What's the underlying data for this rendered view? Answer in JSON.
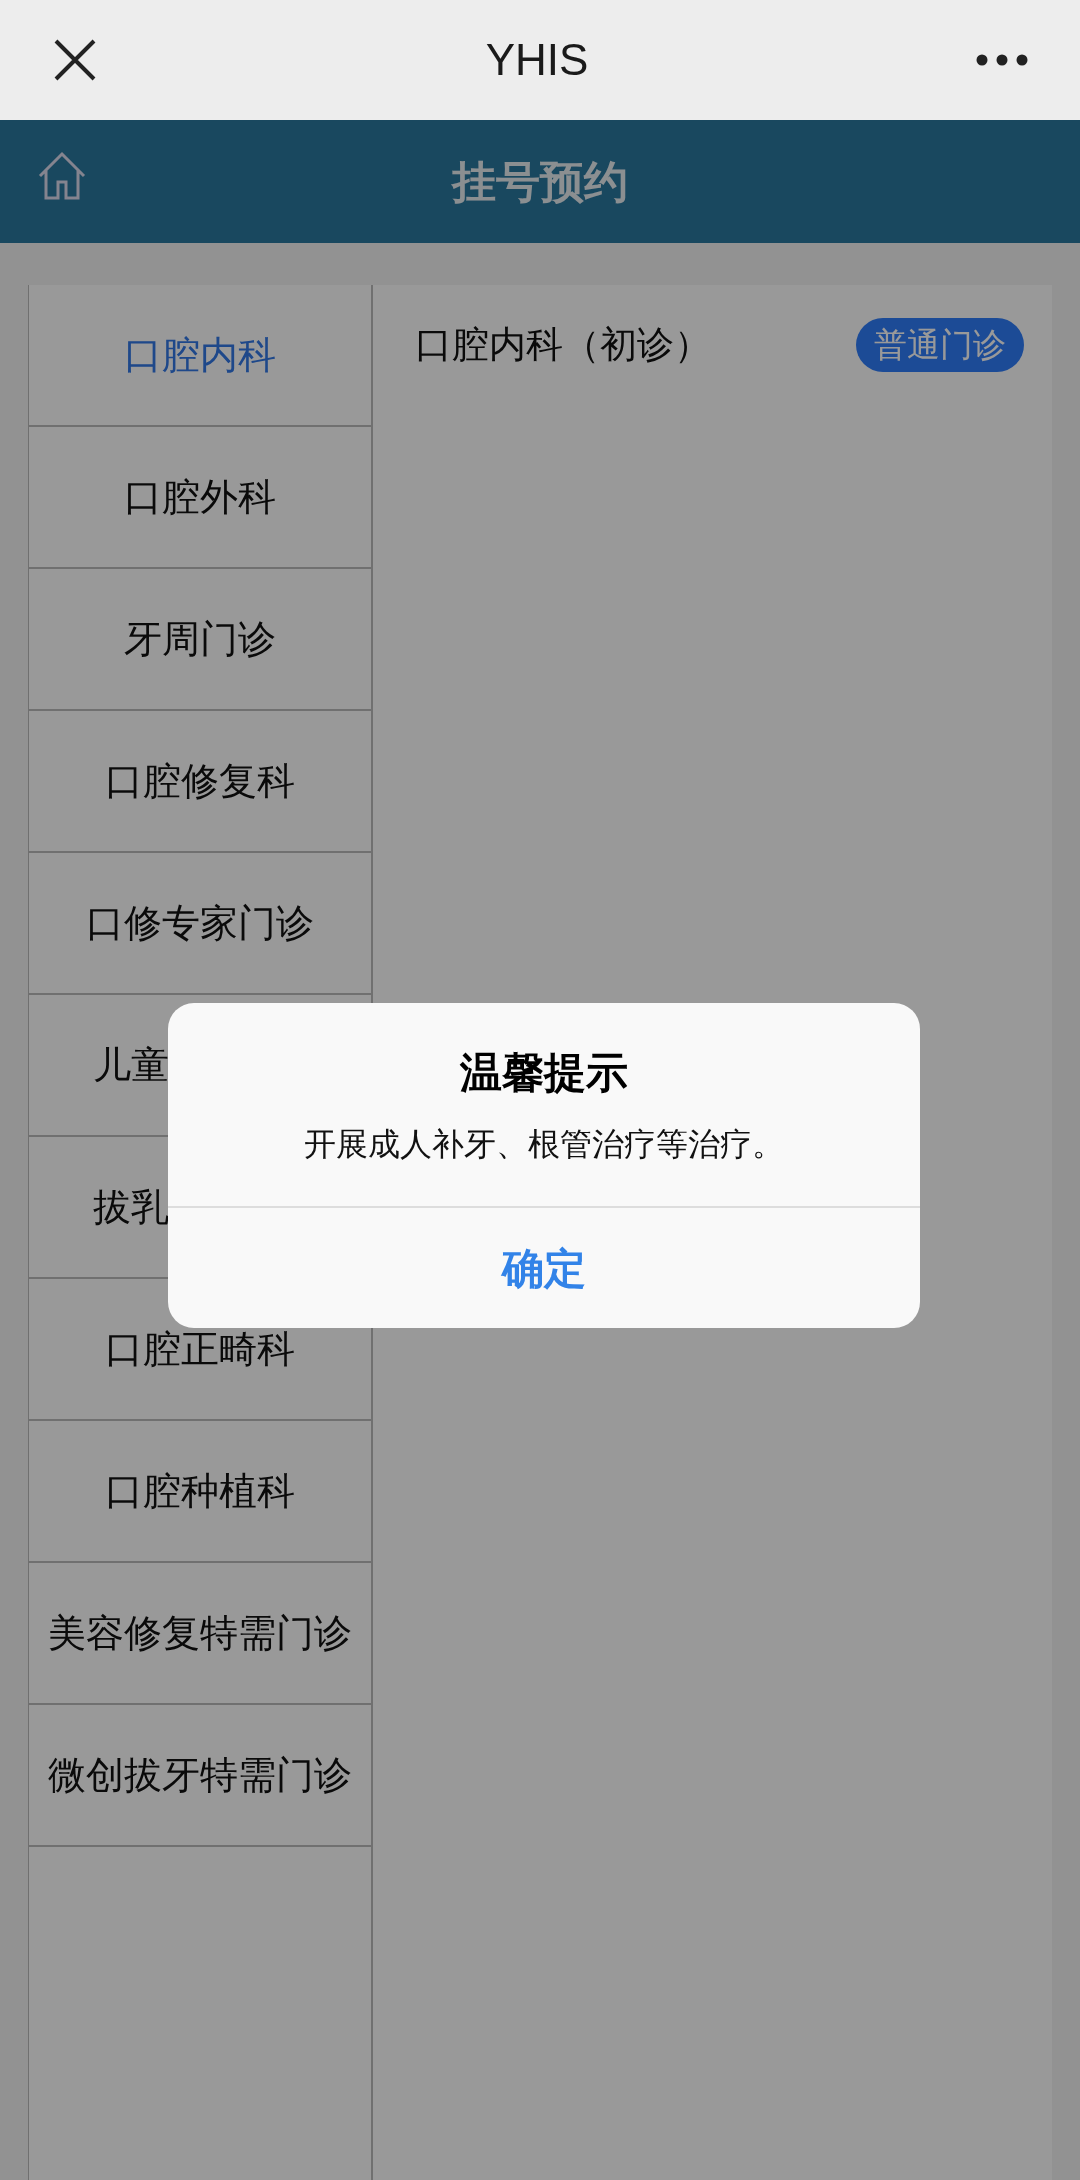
{
  "top_bar": {
    "title": "YHIS"
  },
  "header": {
    "title": "挂号预约"
  },
  "departments": [
    {
      "label": "口腔内科",
      "selected": true,
      "cut_off": false
    },
    {
      "label": "口腔外科",
      "selected": false,
      "cut_off": false
    },
    {
      "label": "牙周门诊",
      "selected": false,
      "cut_off": false
    },
    {
      "label": "口腔修复科",
      "selected": false,
      "cut_off": false
    },
    {
      "label": "口修专家门诊",
      "selected": false,
      "cut_off": false
    },
    {
      "label": "儿童",
      "selected": false,
      "cut_off": true
    },
    {
      "label": "拔乳",
      "selected": false,
      "cut_off": true
    },
    {
      "label": "口腔正畸科",
      "selected": false,
      "cut_off": false
    },
    {
      "label": "口腔种植科",
      "selected": false,
      "cut_off": false
    },
    {
      "label": "美容修复特需门诊",
      "selected": false,
      "cut_off": false
    },
    {
      "label": "微创拔牙特需门诊",
      "selected": false,
      "cut_off": false
    }
  ],
  "clinics": [
    {
      "name": "口腔内科（初诊）",
      "badge": "普通门诊"
    }
  ],
  "dialog": {
    "title": "温馨提示",
    "message": "开展成人补牙、根管治疗等治疗。",
    "button": "确定"
  }
}
